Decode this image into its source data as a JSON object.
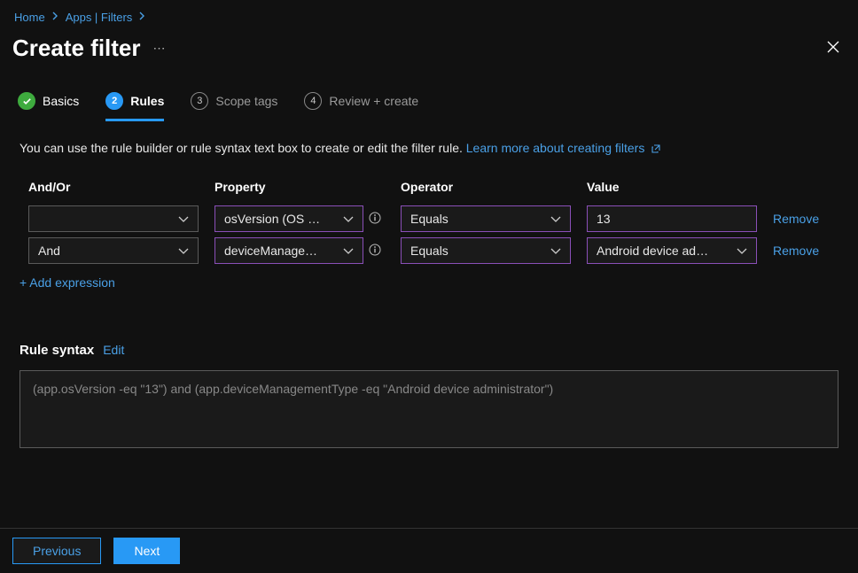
{
  "breadcrumb": {
    "home": "Home",
    "apps": "Apps | Filters"
  },
  "page": {
    "title": "Create filter"
  },
  "tabs": {
    "basics": "Basics",
    "rules": "Rules",
    "scope": "Scope tags",
    "review": "Review + create",
    "n3": "3",
    "n4": "4"
  },
  "description": {
    "text": "You can use the rule builder or rule syntax text box to create or edit the filter rule. ",
    "link": "Learn more about creating filters"
  },
  "columns": {
    "andor": "And/Or",
    "property": "Property",
    "operator": "Operator",
    "value": "Value"
  },
  "rows": [
    {
      "andor": "",
      "property": "osVersion (OS …",
      "operator": "Equals",
      "value": "13",
      "remove": "Remove"
    },
    {
      "andor": "And",
      "property": "deviceManage…",
      "operator": "Equals",
      "value": "Android device ad…",
      "remove": "Remove"
    }
  ],
  "addExpression": "+ Add expression",
  "ruleSyntax": {
    "label": "Rule syntax",
    "edit": "Edit",
    "text": "(app.osVersion -eq \"13\") and (app.deviceManagementType -eq \"Android device administrator\")"
  },
  "footer": {
    "previous": "Previous",
    "next": "Next"
  }
}
